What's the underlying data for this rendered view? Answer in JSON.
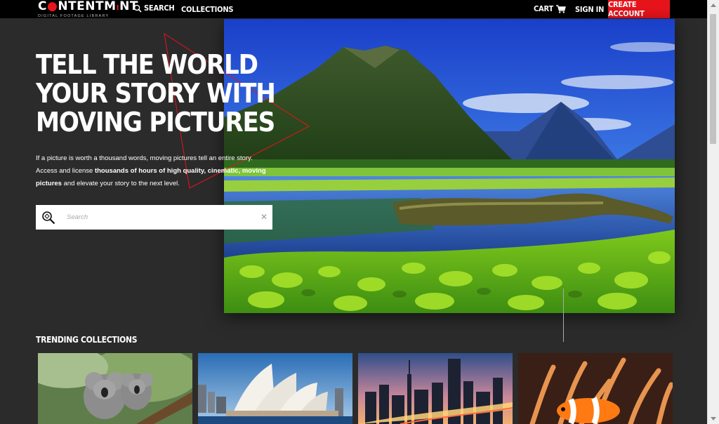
{
  "nav": {
    "logo_main_a": "C",
    "logo_main_b": "NTENTM",
    "logo_main_c": "NT",
    "logo_sub": "DIGITAL FOOTAGE LIBRARY",
    "search_label": "SEARCH",
    "collections_label": "COLLECTIONS",
    "cart_label": "CART",
    "signin_label": "SIGN IN",
    "create_account_label": "CREATE ACCOUNT"
  },
  "hero": {
    "headline_line1": "TELL THE WORLD",
    "headline_line2": "YOUR STORY WITH",
    "headline_line3": "MOVING PICTURES",
    "intro_part1": "If a picture is worth a thousand words, moving pictures tell an entire story. Access and license ",
    "intro_bold1": "thousands of hours of high quality, cinematic, moving pictures",
    "intro_part2": " and elevate your story to the next level.",
    "search_placeholder": "Search",
    "clear_glyph": "✕"
  },
  "trending": {
    "title": "TRENDING COLLECTIONS",
    "cards": [
      {
        "icon": "koala-image"
      },
      {
        "icon": "opera-house-image"
      },
      {
        "icon": "city-skyline-image"
      },
      {
        "icon": "clownfish-image"
      }
    ]
  },
  "colors": {
    "accent": "#e8141c",
    "background": "#2b2b2b",
    "topbar": "#000000"
  }
}
